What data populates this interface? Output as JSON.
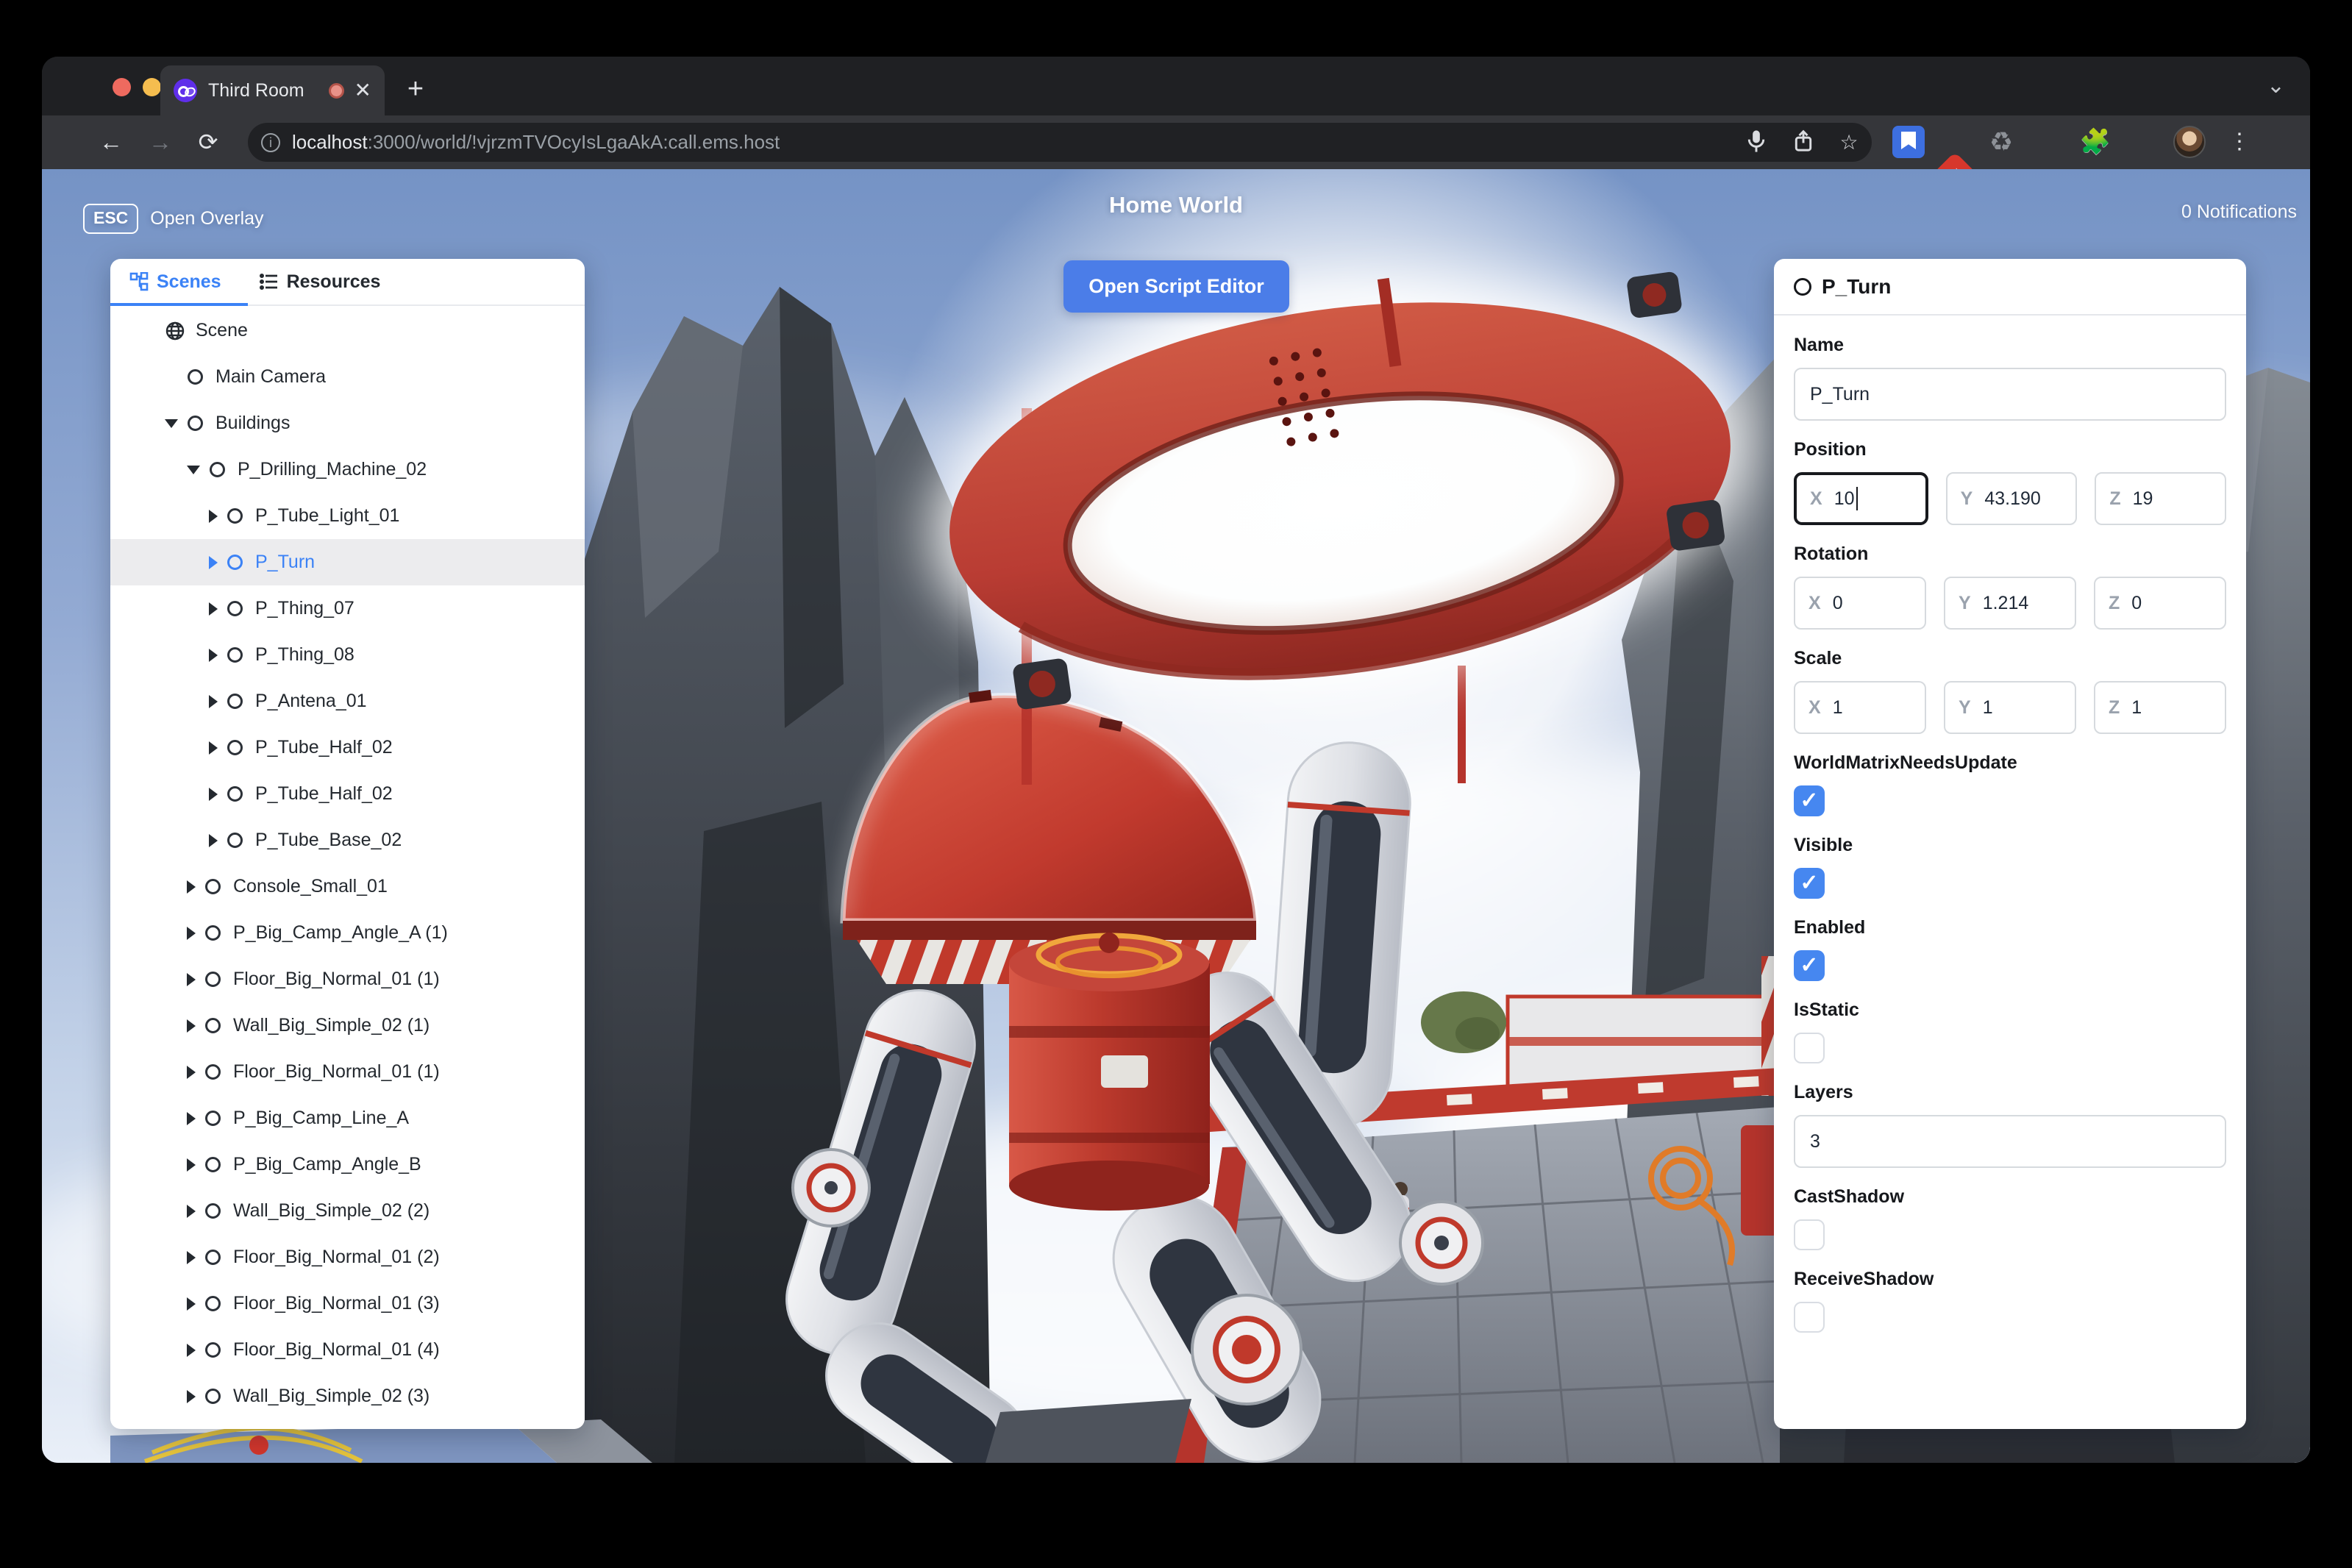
{
  "browser": {
    "tab_title": "Third Room",
    "new_tab_label": "+",
    "tab_chevron": "⌄",
    "close_glyph": "✕",
    "url_host": "localhost",
    "url_rest": ":3000/world/!vjrzmTVOcyIsLgaAkA:call.ems.host",
    "info_glyph": "ⓘ"
  },
  "hud": {
    "esc_key": "ESC",
    "open_overlay": "Open Overlay",
    "world_title": "Home World",
    "notifications": "0 Notifications",
    "open_script_editor": "Open Script Editor"
  },
  "left_panel": {
    "tabs": [
      {
        "label": "Scenes",
        "active": true,
        "icon": "hierarchy-icon"
      },
      {
        "label": "Resources",
        "active": false,
        "icon": "list-icon"
      }
    ],
    "tree": [
      {
        "label": "Scene",
        "level": 0,
        "caret": "none",
        "icon": "globe"
      },
      {
        "label": "Main Camera",
        "level": 1,
        "caret": "none",
        "icon": "circle"
      },
      {
        "label": "Buildings",
        "level": 1,
        "caret": "down",
        "icon": "circle"
      },
      {
        "label": "P_Drilling_Machine_02",
        "level": 2,
        "caret": "down",
        "icon": "circle"
      },
      {
        "label": "P_Tube_Light_01",
        "level": 3,
        "caret": "right",
        "icon": "circle"
      },
      {
        "label": "P_Turn",
        "level": 3,
        "caret": "right",
        "icon": "circle",
        "selected": true
      },
      {
        "label": "P_Thing_07",
        "level": 3,
        "caret": "right",
        "icon": "circle"
      },
      {
        "label": "P_Thing_08",
        "level": 3,
        "caret": "right",
        "icon": "circle"
      },
      {
        "label": "P_Antena_01",
        "level": 3,
        "caret": "right",
        "icon": "circle"
      },
      {
        "label": "P_Tube_Half_02",
        "level": 3,
        "caret": "right",
        "icon": "circle"
      },
      {
        "label": "P_Tube_Half_02",
        "level": 3,
        "caret": "right",
        "icon": "circle"
      },
      {
        "label": "P_Tube_Base_02",
        "level": 3,
        "caret": "right",
        "icon": "circle"
      },
      {
        "label": "Console_Small_01",
        "level": 2,
        "caret": "right",
        "icon": "circle"
      },
      {
        "label": "P_Big_Camp_Angle_A (1)",
        "level": 2,
        "caret": "right",
        "icon": "circle"
      },
      {
        "label": "Floor_Big_Normal_01 (1)",
        "level": 2,
        "caret": "right",
        "icon": "circle"
      },
      {
        "label": "Wall_Big_Simple_02 (1)",
        "level": 2,
        "caret": "right",
        "icon": "circle"
      },
      {
        "label": "Floor_Big_Normal_01 (1)",
        "level": 2,
        "caret": "right",
        "icon": "circle"
      },
      {
        "label": "P_Big_Camp_Line_A",
        "level": 2,
        "caret": "right",
        "icon": "circle"
      },
      {
        "label": "P_Big_Camp_Angle_B",
        "level": 2,
        "caret": "right",
        "icon": "circle"
      },
      {
        "label": "Wall_Big_Simple_02 (2)",
        "level": 2,
        "caret": "right",
        "icon": "circle"
      },
      {
        "label": "Floor_Big_Normal_01 (2)",
        "level": 2,
        "caret": "right",
        "icon": "circle"
      },
      {
        "label": "Floor_Big_Normal_01 (3)",
        "level": 2,
        "caret": "right",
        "icon": "circle"
      },
      {
        "label": "Floor_Big_Normal_01 (4)",
        "level": 2,
        "caret": "right",
        "icon": "circle"
      },
      {
        "label": "Wall_Big_Simple_02 (3)",
        "level": 2,
        "caret": "right",
        "icon": "circle"
      }
    ]
  },
  "inspector": {
    "title": "P_Turn",
    "axis_letters": [
      "X",
      "Y",
      "Z"
    ],
    "check_glyph": "✓",
    "sections": [
      {
        "type": "text",
        "label": "Name",
        "value": "P_Turn"
      },
      {
        "type": "vector",
        "label": "Position",
        "values": [
          "10",
          "43.190",
          "19"
        ],
        "focused": 0
      },
      {
        "type": "vector",
        "label": "Rotation",
        "values": [
          "0",
          "1.214",
          "0"
        ]
      },
      {
        "type": "vector",
        "label": "Scale",
        "values": [
          "1",
          "1",
          "1"
        ]
      },
      {
        "type": "checkbox",
        "label": "WorldMatrixNeedsUpdate",
        "checked": true
      },
      {
        "type": "checkbox",
        "label": "Visible",
        "checked": true
      },
      {
        "type": "checkbox",
        "label": "Enabled",
        "checked": true
      },
      {
        "type": "checkbox",
        "label": "IsStatic",
        "checked": false
      },
      {
        "type": "text",
        "label": "Layers",
        "value": "3"
      },
      {
        "type": "checkbox",
        "label": "CastShadow",
        "checked": false
      },
      {
        "type": "checkbox",
        "label": "ReceiveShadow",
        "checked": false
      }
    ]
  },
  "colors": {
    "accent_blue": "#3b82f6",
    "button_blue": "#4b7de8",
    "checkbox_blue": "#4687f0",
    "selection_row": "#ececee",
    "machine_red": "#b93c33",
    "tabbar_bg": "#1f2023",
    "toolbar_bg": "#35363a",
    "urlpill_bg": "#202124"
  }
}
